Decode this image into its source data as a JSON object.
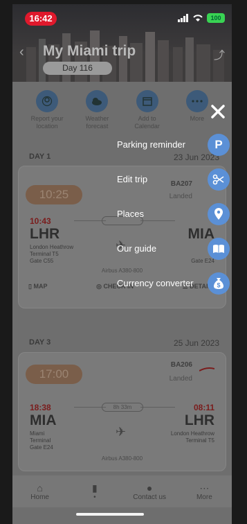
{
  "status": {
    "time": "16:42",
    "battery": "100"
  },
  "header": {
    "title": "My Miami trip",
    "day": "Day 116"
  },
  "actions": [
    {
      "label": "Report your location",
      "icon": "location-report-icon"
    },
    {
      "label": "Weather forecast",
      "icon": "weather-icon"
    },
    {
      "label": "Add to Calendar",
      "icon": "calendar-icon"
    },
    {
      "label": "More",
      "icon": "more-icon"
    }
  ],
  "day1": {
    "label": "DAY 1",
    "date": "23 Jun 2023"
  },
  "flight1": {
    "departure_pill": "10:25",
    "flight_no": "BA207",
    "status": "Landed",
    "dep_time": "10:43",
    "dep_code": "LHR",
    "dep_airport": "London Heathrow",
    "dep_terminal": "Terminal T5",
    "dep_gate": "Gate C55",
    "arr_code": "MIA",
    "arr_gate": "Gate E24",
    "aircraft": "Airbus A380-800",
    "map_label": "MAP",
    "checkin_label": "CHECK IN",
    "details_label": "DETAILS"
  },
  "day3": {
    "label": "DAY 3",
    "date": "25 Jun 2023"
  },
  "flight2": {
    "departure_pill": "17:00",
    "flight_no": "BA206",
    "status": "Landed",
    "dep_time": "18:38",
    "arr_time": "08:11",
    "duration": "8h 33m",
    "dep_code": "MIA",
    "dep_airport": "Miami",
    "dep_terminal": "Terminal",
    "dep_gate": "Gate E24",
    "arr_code": "LHR",
    "arr_airport": "London Heathrow",
    "arr_terminal": "Terminal T5",
    "aircraft": "Airbus A380-800"
  },
  "tabs": [
    {
      "label": "Home",
      "icon": "home-icon"
    },
    {
      "label": "",
      "icon": "trips-icon"
    },
    {
      "label": "Contact us",
      "icon": "contact-icon"
    },
    {
      "label": "More",
      "icon": "more-icon"
    }
  ],
  "menu": [
    {
      "label": "Parking reminder",
      "icon": "parking-icon"
    },
    {
      "label": "Edit trip",
      "icon": "scissors-icon"
    },
    {
      "label": "Places",
      "icon": "location-pin-icon"
    },
    {
      "label": "Our guide",
      "icon": "book-icon"
    },
    {
      "label": "Currency converter",
      "icon": "money-bag-icon"
    }
  ],
  "colors": {
    "menu_icon_bg": "#5b90d6",
    "time_pill": "#e0192c",
    "battery": "#39d353"
  }
}
